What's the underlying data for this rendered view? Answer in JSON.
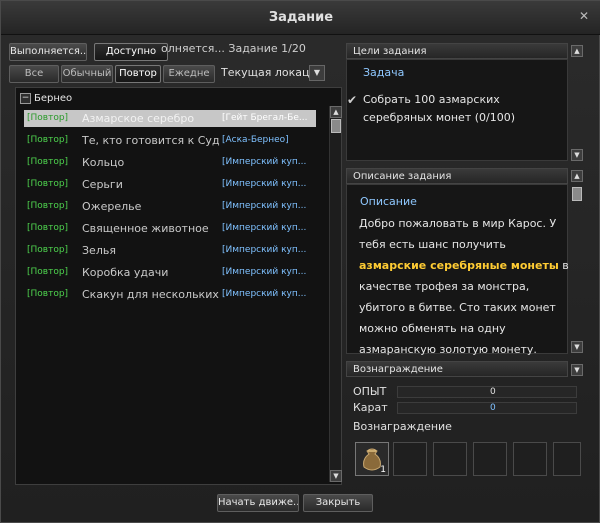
{
  "window": {
    "title": "Задание"
  },
  "tabs": {
    "in_progress": "Выполняется...",
    "available": "Доступно",
    "counter": "олняется... Задание 1/20"
  },
  "filters": {
    "all": "Все",
    "normal": "Обычный",
    "repeat": "Повтор",
    "daily": "Ежедне",
    "location": "Текущая локац"
  },
  "list": {
    "group": "Бернео",
    "rows": [
      {
        "tag": "[Повтор]",
        "name": "Азмарское серебро",
        "giver": "[Гейт Брегал-Бе..."
      },
      {
        "tag": "[Повтор]",
        "name": "Те, кто готовится к Суд",
        "giver": "[Аска-Бернео]"
      },
      {
        "tag": "[Повтор]",
        "name": "Кольцо",
        "giver": "[Имперский куп..."
      },
      {
        "tag": "[Повтор]",
        "name": "Серьги",
        "giver": "[Имперский куп..."
      },
      {
        "tag": "[Повтор]",
        "name": "Ожерелье",
        "giver": "[Имперский куп..."
      },
      {
        "tag": "[Повтор]",
        "name": "Священное животное",
        "giver": "[Имперский куп..."
      },
      {
        "tag": "[Повтор]",
        "name": "Зелья",
        "giver": "[Имперский куп..."
      },
      {
        "tag": "[Повтор]",
        "name": "Коробка удачи",
        "giver": "[Имперский куп..."
      },
      {
        "tag": "[Повтор]",
        "name": "Скакун для нескольких",
        "giver": "[Имперский куп..."
      }
    ]
  },
  "goals": {
    "header": "Цели задания",
    "title": "Задача",
    "text": "Собрать 100 азмарских серебряных монет (0/100)"
  },
  "description": {
    "header": "Описание задания",
    "title": "Описание",
    "text_before": "Добро пожаловать в мир Карос. У тебя есть шанс получить ",
    "highlight": "азмарские серебряные монеты",
    "text_after": " в качестве трофея за монстра, убитого в битве. Сто таких монет можно обменять на одну азмаранскую золотую монету."
  },
  "reward": {
    "header": "Вознаграждение",
    "exp_label": "ОПЫТ",
    "exp_value": "0",
    "carat_label": "Карат",
    "carat_value": "0",
    "items_label": "Вознаграждение",
    "bag_count": "1"
  },
  "buttons": {
    "start": "Начать движе...",
    "close": "Закрыть"
  }
}
